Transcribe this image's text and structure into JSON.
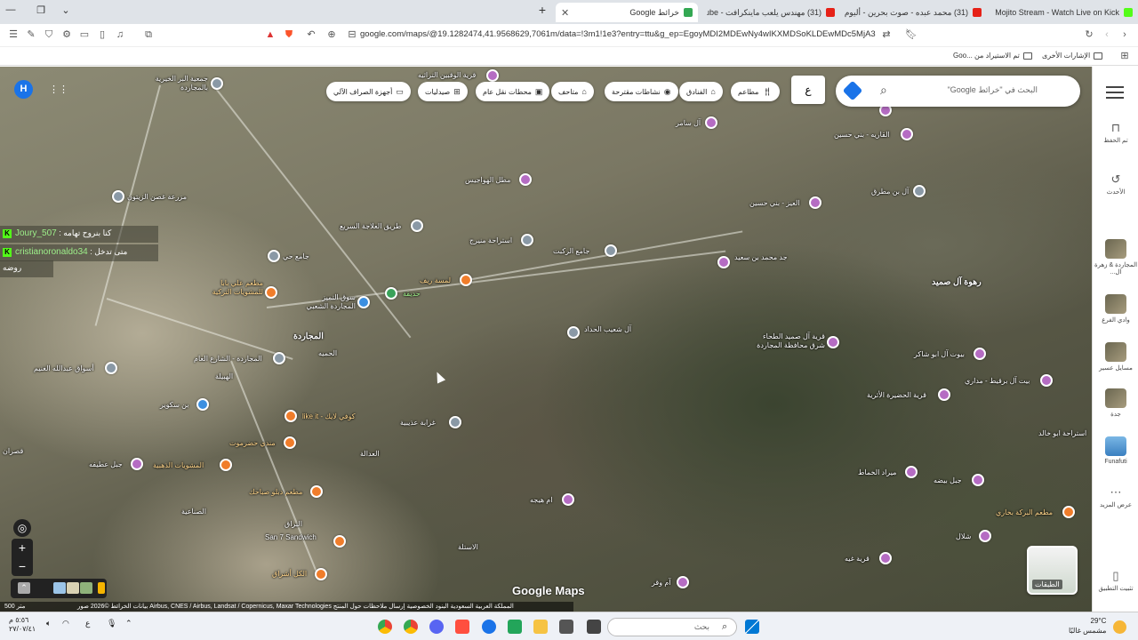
{
  "browser": {
    "tabs": [
      {
        "title": "خرائط Google",
        "active": true
      },
      {
        "title": "(31) مهندس يلعب ماينكرافت - YouTube",
        "active": false
      },
      {
        "title": "(31) محمد عبده - صوت بحرين - أليوم",
        "active": false
      },
      {
        "title": "Mojito Stream - Watch Live on Kick",
        "active": false
      }
    ],
    "new_tab": "+",
    "url": "google.com/maps/@19.1282474,41.9568629,7061m/data=!3m1!1e3?entry=ttu&g_ep=EgoyMDI2MDEwNy4wIKXMDSoKLDEwMDc5MjA3...",
    "bookmarks": [
      {
        "label": "الإشارات الأخرى"
      },
      {
        "label": "تم الاستيراد من ...Goo"
      }
    ]
  },
  "map": {
    "search_placeholder": "البحث في \"خرائط Google\"",
    "language_button": "ع",
    "avatar_letter": "H",
    "chips": [
      {
        "label": "مطاعم",
        "icon": "🍴"
      },
      {
        "label": "الفنادق",
        "icon": "🛏"
      },
      {
        "label": "نشاطات مقترحة",
        "icon": "📷"
      },
      {
        "label": "متاحف",
        "icon": "🏛"
      },
      {
        "label": "محطات نقل عام",
        "icon": "🚌"
      },
      {
        "label": "صيدليات",
        "icon": "💊"
      },
      {
        "label": "أجهزة الصراف الآلي",
        "icon": "💳"
      }
    ],
    "chat": [
      {
        "user": "Joury_507",
        "message": "كنا بنروح تهامه"
      },
      {
        "user": "cristianoronaldo34",
        "message": "متى تدخل"
      },
      {
        "user": "",
        "message": "روضه"
      }
    ],
    "places": [
      {
        "label": "قرية الوقبين التراثيه",
        "color": "purple"
      },
      {
        "label": "آل سامر",
        "color": "purple"
      },
      {
        "label": "القاريه - بني حسين",
        "color": "purple"
      },
      {
        "label": "جمعية البر الخيرية بالمجاردة",
        "color": "gray"
      },
      {
        "label": "مطل الهواجيس",
        "color": "purple"
      },
      {
        "label": "مزرعة غصن الزيتون",
        "color": "gray"
      },
      {
        "label": "آل بن مطرق",
        "color": "gray"
      },
      {
        "label": "العيز - بني حسين",
        "color": "purple"
      },
      {
        "label": "طريق العلاجة السريع",
        "color": "gray"
      },
      {
        "label": "استراحة منيرج",
        "color": "gray"
      },
      {
        "label": "جامع الركبت",
        "color": "gray"
      },
      {
        "label": "جامع حي",
        "color": "gray"
      },
      {
        "label": "جد محمد بن سعيد",
        "color": "purple"
      },
      {
        "label": "رهوة آل صميد",
        "color": "none"
      },
      {
        "label": "مطعم علي بابا للمشويات التركية",
        "color": "orange"
      },
      {
        "label": "لمسة ريف",
        "color": "orange"
      },
      {
        "label": "حديقة",
        "color": "green"
      },
      {
        "label": "سوق التميز المجاردة الشعبي",
        "color": "blue"
      },
      {
        "label": "آل شعيب الحداد",
        "color": "gray"
      },
      {
        "label": "قرية آل صميد الطحاء شرق محافظة المجاردة",
        "color": "purple"
      },
      {
        "label": "بيوت آل ابو شاكر",
        "color": "purple"
      },
      {
        "label": "المجاردة",
        "color": "none"
      },
      {
        "label": "أسواق عبدالله الغنيم",
        "color": "gray"
      },
      {
        "label": "المجاردة - الشارع العام",
        "color": "gray"
      },
      {
        "label": "بيت آل برقيط - مداري",
        "color": "purple"
      },
      {
        "label": "قرية الحضيرة الأثرية",
        "color": "purple"
      },
      {
        "label": "بن سكوير",
        "color": "blue"
      },
      {
        "label": "كوفي لايك - like it",
        "color": "orange"
      },
      {
        "label": "غرابة عذيبية",
        "color": "gray"
      },
      {
        "label": "استراحة ابو خالد",
        "color": "none"
      },
      {
        "label": "جبل عطيفه",
        "color": "purple"
      },
      {
        "label": "المشويات الذهبية",
        "color": "orange"
      },
      {
        "label": "مندي حضرموت",
        "color": "orange"
      },
      {
        "label": "ميراد الخماط",
        "color": "purple"
      },
      {
        "label": "جبل بيضه",
        "color": "purple"
      },
      {
        "label": "ام هيجه",
        "color": "purple"
      },
      {
        "label": "مطعم دبلو صباحك",
        "color": "orange"
      },
      {
        "label": "San 7 Sandwich",
        "color": "orange"
      },
      {
        "label": "مطعم البركة بخاري",
        "color": "orange"
      },
      {
        "label": "شلال",
        "color": "purple"
      },
      {
        "label": "قرية غيه",
        "color": "purple"
      },
      {
        "label": "آم وقر",
        "color": "purple"
      },
      {
        "label": "الكل أشراق",
        "color": "orange"
      }
    ],
    "area_labels": [
      "العدالة",
      "الهبيلة",
      "الحميه",
      "الصناعية",
      "قصران",
      "البراق",
      "الاستلة"
    ],
    "logo": "Google Maps",
    "layers_label": "الطبقات",
    "scale": "500 متر",
    "footer": "بيانات الخرائط ©2026 صور Airbus, CNES / Airbus, Landsat / Copernicus, Maxar Technologies  المملكة العربية السعودية  البنود  الخصوصية  إرسال ملاحظات حول المنتج"
  },
  "sidebar": {
    "items": [
      {
        "label": "تم الحفظ",
        "icon": "bookmark-icon"
      },
      {
        "label": "الأحدث",
        "icon": "history-icon"
      },
      {
        "label": "المجاردة & زهرة ال...",
        "icon": "thumbnail"
      },
      {
        "label": "وادي الفرع",
        "icon": "thumbnail"
      },
      {
        "label": "مسايل عسير",
        "icon": "thumbnail"
      },
      {
        "label": "جدة",
        "icon": "thumbnail"
      },
      {
        "label": "Funafuti",
        "icon": "thumbnail"
      },
      {
        "label": "عرض المزيد",
        "icon": "more-icon"
      },
      {
        "label": "تثبيت التطبيق",
        "icon": "install-icon"
      }
    ]
  },
  "taskbar": {
    "search_placeholder": "بحث",
    "weather_temp": "29°C",
    "weather_desc": "مشمس غالبًا",
    "time": "٥:٥٦ م",
    "date": "٢٧/٠٧/٤١",
    "lang": "ع"
  },
  "colors": {
    "accent": "#1a73e8",
    "purple_pin": "#b56cc3",
    "orange_pin": "#f07d2b"
  }
}
